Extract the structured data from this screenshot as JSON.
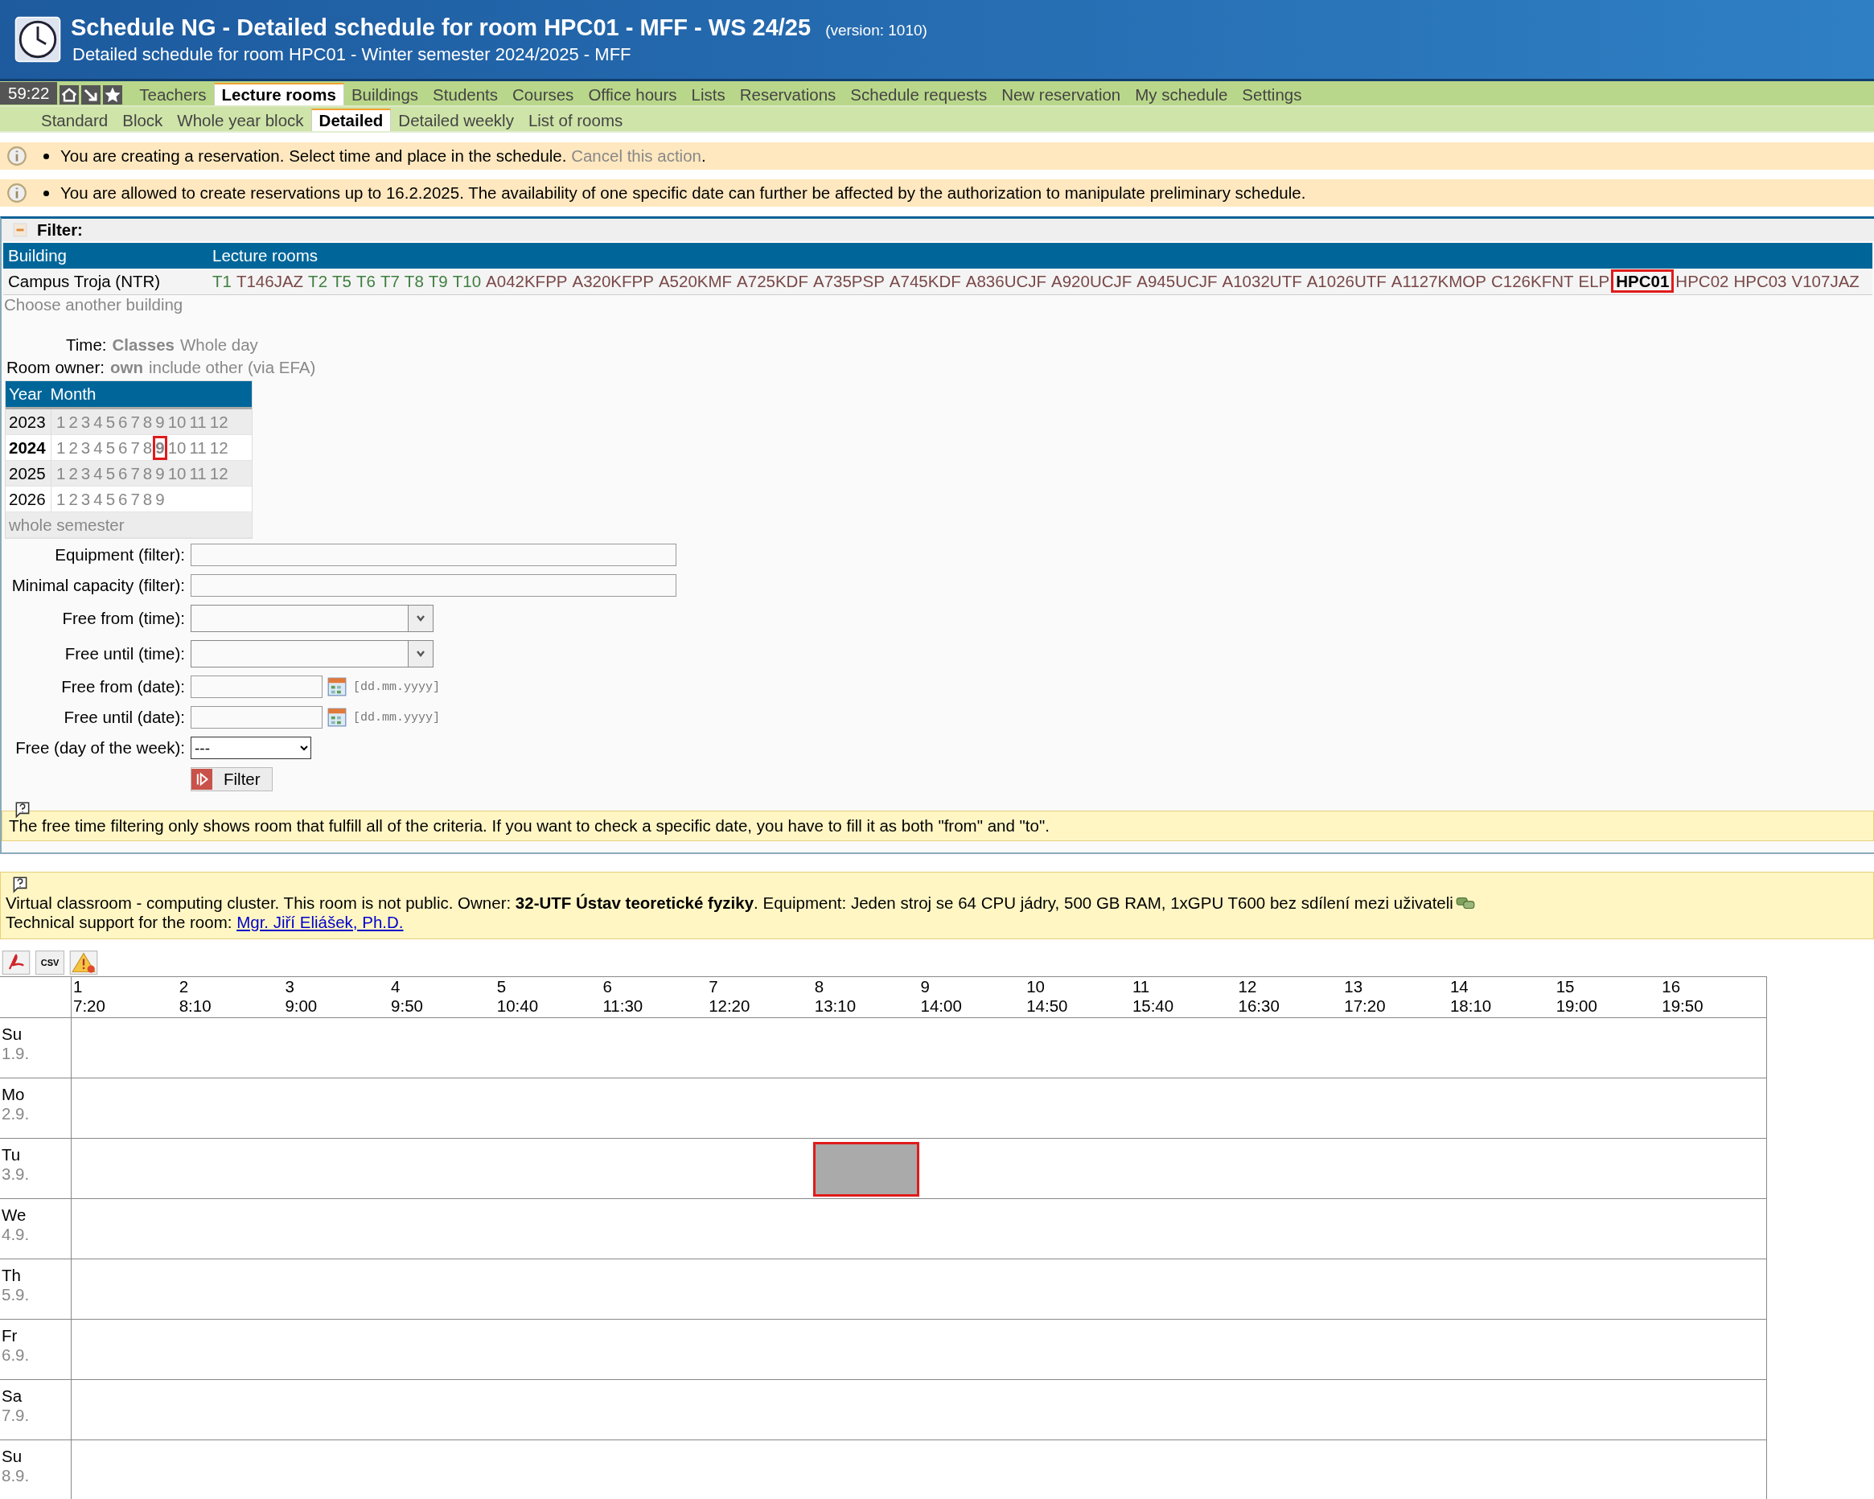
{
  "header": {
    "title": "Schedule NG - Detailed schedule for room HPC01 - MFF - WS 24/25",
    "version": "(version: 1010)",
    "subtitle": "Detailed schedule for room HPC01 - Winter semester 2024/2025 - MFF"
  },
  "nav": {
    "clock": "59:22",
    "tabs": [
      {
        "label": "Teachers",
        "selected": false
      },
      {
        "label": "Lecture rooms",
        "selected": true
      },
      {
        "label": "Buildings",
        "selected": false
      },
      {
        "label": "Students",
        "selected": false
      },
      {
        "label": "Courses",
        "selected": false
      },
      {
        "label": "Office hours",
        "selected": false
      },
      {
        "label": "Lists",
        "selected": false
      },
      {
        "label": "Reservations",
        "selected": false
      },
      {
        "label": "Schedule requests",
        "selected": false
      },
      {
        "label": "New reservation",
        "selected": false
      },
      {
        "label": "My schedule",
        "selected": false
      },
      {
        "label": "Settings",
        "selected": false
      }
    ],
    "subtabs": [
      {
        "label": "Standard",
        "selected": false
      },
      {
        "label": "Block",
        "selected": false
      },
      {
        "label": "Whole year block",
        "selected": false
      },
      {
        "label": "Detailed",
        "selected": true
      },
      {
        "label": "Detailed weekly",
        "selected": false
      },
      {
        "label": "List of rooms",
        "selected": false
      }
    ]
  },
  "notices": [
    {
      "text": "You are creating a reservation. Select time and place in the schedule.",
      "link": "Cancel this action",
      "tail": "."
    },
    {
      "text": "You are allowed to create reservations up to 16.2.2025. The availability of one specific date can further be affected by the authorization to manipulate preliminary schedule."
    }
  ],
  "filter": {
    "title": "Filter:",
    "expanded": true,
    "table": {
      "columns": [
        "Building",
        "Lecture rooms"
      ],
      "building": "Campus Troja (NTR)",
      "rooms": [
        {
          "label": "T1",
          "color": "#3f7f3f",
          "selected": false
        },
        {
          "label": "T146JAZ",
          "color": "#7a4848",
          "selected": false
        },
        {
          "label": "T2",
          "color": "#3f7f3f",
          "selected": false
        },
        {
          "label": "T5",
          "color": "#3f7f3f",
          "selected": false
        },
        {
          "label": "T6",
          "color": "#3f7f3f",
          "selected": false
        },
        {
          "label": "T7",
          "color": "#3f7f3f",
          "selected": false
        },
        {
          "label": "T8",
          "color": "#3f7f3f",
          "selected": false
        },
        {
          "label": "T9",
          "color": "#3f7f3f",
          "selected": false
        },
        {
          "label": "T10",
          "color": "#3f7f3f",
          "selected": false
        },
        {
          "label": "A042KFPP",
          "color": "#7a4848",
          "selected": false
        },
        {
          "label": "A320KFPP",
          "color": "#7a4848",
          "selected": false
        },
        {
          "label": "A520KMF",
          "color": "#7a4848",
          "selected": false
        },
        {
          "label": "A725KDF",
          "color": "#7a4848",
          "selected": false
        },
        {
          "label": "A735PSP",
          "color": "#7a4848",
          "selected": false
        },
        {
          "label": "A745KDF",
          "color": "#7a4848",
          "selected": false
        },
        {
          "label": "A836UCJF",
          "color": "#7a4848",
          "selected": false
        },
        {
          "label": "A920UCJF",
          "color": "#7a4848",
          "selected": false
        },
        {
          "label": "A945UCJF",
          "color": "#7a4848",
          "selected": false
        },
        {
          "label": "A1032UTF",
          "color": "#7a4848",
          "selected": false
        },
        {
          "label": "A1026UTF",
          "color": "#7a4848",
          "selected": false
        },
        {
          "label": "A1127KMOP",
          "color": "#7a4848",
          "selected": false
        },
        {
          "label": "C126KFNT",
          "color": "#7a4848",
          "selected": false
        },
        {
          "label": "ELP",
          "color": "#7a4848",
          "selected": false
        },
        {
          "label": "HPC01",
          "color": "#000000",
          "selected": true
        },
        {
          "label": "HPC02",
          "color": "#7a4848",
          "selected": false
        },
        {
          "label": "HPC03",
          "color": "#7a4848",
          "selected": false
        },
        {
          "label": "V107JAZ",
          "color": "#7a4848",
          "selected": false
        }
      ],
      "choose_link": "Choose another building"
    },
    "time": {
      "label": "Time:",
      "options": [
        {
          "label": "Classes",
          "selected": true
        },
        {
          "label": "Whole day",
          "selected": false
        }
      ]
    },
    "owner": {
      "label": "Room owner:",
      "options": [
        {
          "label": "own",
          "selected": true
        },
        {
          "label": "include other (via EFA)",
          "selected": false
        }
      ]
    },
    "calendar": {
      "columns": [
        "Year",
        "Month"
      ],
      "years": [
        {
          "year": "2023",
          "selected": false,
          "months": [
            {
              "label": "1",
              "selected": false
            },
            {
              "label": "2",
              "selected": false
            },
            {
              "label": "3",
              "selected": false
            },
            {
              "label": "4",
              "selected": false
            },
            {
              "label": "5",
              "selected": false
            },
            {
              "label": "6",
              "selected": false
            },
            {
              "label": "7",
              "selected": false
            },
            {
              "label": "8",
              "selected": false
            },
            {
              "label": "9",
              "selected": false
            },
            {
              "label": "10",
              "selected": false
            },
            {
              "label": "11",
              "selected": false
            },
            {
              "label": "12",
              "selected": false
            }
          ]
        },
        {
          "year": "2024",
          "selected": true,
          "months": [
            {
              "label": "1",
              "selected": false
            },
            {
              "label": "2",
              "selected": false
            },
            {
              "label": "3",
              "selected": false
            },
            {
              "label": "4",
              "selected": false
            },
            {
              "label": "5",
              "selected": false
            },
            {
              "label": "6",
              "selected": false
            },
            {
              "label": "7",
              "selected": false
            },
            {
              "label": "8",
              "selected": false
            },
            {
              "label": "9",
              "selected": true
            },
            {
              "label": "10",
              "selected": false
            },
            {
              "label": "11",
              "selected": false
            },
            {
              "label": "12",
              "selected": false
            }
          ]
        },
        {
          "year": "2025",
          "selected": false,
          "months": [
            {
              "label": "1",
              "selected": false
            },
            {
              "label": "2",
              "selected": false
            },
            {
              "label": "3",
              "selected": false
            },
            {
              "label": "4",
              "selected": false
            },
            {
              "label": "5",
              "selected": false
            },
            {
              "label": "6",
              "selected": false
            },
            {
              "label": "7",
              "selected": false
            },
            {
              "label": "8",
              "selected": false
            },
            {
              "label": "9",
              "selected": false
            },
            {
              "label": "10",
              "selected": false
            },
            {
              "label": "11",
              "selected": false
            },
            {
              "label": "12",
              "selected": false
            }
          ]
        },
        {
          "year": "2026",
          "selected": false,
          "months": [
            {
              "label": "1",
              "selected": false
            },
            {
              "label": "2",
              "selected": false
            },
            {
              "label": "3",
              "selected": false
            },
            {
              "label": "4",
              "selected": false
            },
            {
              "label": "5",
              "selected": false
            },
            {
              "label": "6",
              "selected": false
            },
            {
              "label": "7",
              "selected": false
            },
            {
              "label": "8",
              "selected": false
            },
            {
              "label": "9",
              "selected": false
            }
          ]
        }
      ],
      "whole_semester": "whole semester"
    },
    "fields": [
      {
        "label": "Equipment (filter):",
        "kind": "text"
      },
      {
        "label": "Minimal capacity (filter):",
        "kind": "text"
      },
      {
        "label": "Free from (time):",
        "kind": "combo"
      },
      {
        "label": "Free until (time):",
        "kind": "combo"
      },
      {
        "label": "Free from (date):",
        "kind": "date",
        "hint": "[dd.mm.yyyy]"
      },
      {
        "label": "Free until (date):",
        "kind": "date",
        "hint": "[dd.mm.yyyy]"
      },
      {
        "label": "Free (day of the week):",
        "kind": "select",
        "selection": "---"
      }
    ],
    "button": "Filter",
    "help": "The free time filtering only shows room that fulfill all of the criteria. If you want to check a specific date, you have to fill it as both \"from\" and \"to\"."
  },
  "room_info": {
    "text": "Virtual classroom - computing cluster. This room is not public. Owner: **32-UTF Ústav teoretické fyziky**. Equipment: Jeden stroj se 64 CPU jádry, 500 GB RAM, 1xGPU T600 bez sdílení mezi uživateli",
    "support_label": "Technical support for the room:",
    "support_link": "Mgr. Jiří Eliášek, Ph.D."
  },
  "exports": [
    {
      "kind": "pdf"
    },
    {
      "kind": "csv",
      "label": "CSV"
    },
    {
      "kind": "warning"
    }
  ],
  "schedule": {
    "slots": [
      {
        "num": "1",
        "time": "7:20"
      },
      {
        "num": "2",
        "time": "8:10"
      },
      {
        "num": "3",
        "time": "9:00"
      },
      {
        "num": "4",
        "time": "9:50"
      },
      {
        "num": "5",
        "time": "10:40"
      },
      {
        "num": "6",
        "time": "11:30"
      },
      {
        "num": "7",
        "time": "12:20"
      },
      {
        "num": "8",
        "time": "13:10"
      },
      {
        "num": "9",
        "time": "14:00"
      },
      {
        "num": "10",
        "time": "14:50"
      },
      {
        "num": "11",
        "time": "15:40"
      },
      {
        "num": "12",
        "time": "16:30"
      },
      {
        "num": "13",
        "time": "17:20"
      },
      {
        "num": "14",
        "time": "18:10"
      },
      {
        "num": "15",
        "time": "19:00"
      },
      {
        "num": "16",
        "time": "19:50"
      }
    ],
    "days": [
      {
        "name": "Su",
        "date": "1.9."
      },
      {
        "name": "Mo",
        "date": "2.9."
      },
      {
        "name": "Tu",
        "date": "3.9.",
        "cells": [
          {
            "kind": "empty"
          },
          {
            "kind": "empty"
          },
          {
            "kind": "empty"
          },
          {
            "kind": "empty"
          },
          {
            "kind": "empty"
          },
          {
            "kind": "empty"
          },
          {
            "kind": "empty"
          },
          {
            "kind": "reservation",
            "selected": true
          },
          {
            "kind": "empty"
          },
          {
            "kind": "empty"
          },
          {
            "kind": "empty"
          },
          {
            "kind": "empty"
          },
          {
            "kind": "empty"
          },
          {
            "kind": "empty"
          },
          {
            "kind": "empty"
          },
          {
            "kind": "empty"
          }
        ]
      },
      {
        "name": "We",
        "date": "4.9."
      },
      {
        "name": "Th",
        "date": "5.9."
      },
      {
        "name": "Fr",
        "date": "6.9."
      },
      {
        "name": "Sa",
        "date": "7.9."
      },
      {
        "name": "Su",
        "date": "8.9."
      }
    ]
  }
}
